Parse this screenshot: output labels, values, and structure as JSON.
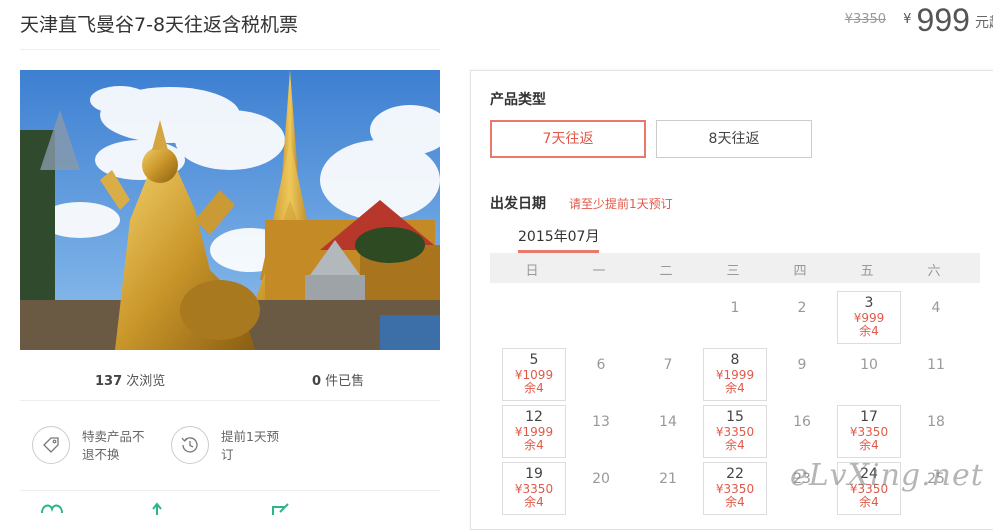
{
  "product": {
    "title": "天津直飞曼谷7-8天往返含税机票",
    "old_price": "¥3350",
    "currency": "¥",
    "price": "999",
    "price_unit": "元起"
  },
  "stats": {
    "views_count": "137",
    "views_label": " 次浏览",
    "sold_count": "0",
    "sold_label": " 件已售"
  },
  "features": [
    {
      "text": "特卖产品不退不换",
      "icon": "tag-icon"
    },
    {
      "text": "提前1天预订",
      "icon": "clock-history-icon"
    }
  ],
  "booking": {
    "type_label": "产品类型",
    "types": [
      "7天往返",
      "8天往返"
    ],
    "selected_type": "7天往返",
    "date_label": "出发日期",
    "date_hint": "请至少提前1天预订",
    "month": "2015年07月",
    "weekdays": [
      "日",
      "一",
      "二",
      "三",
      "四",
      "五",
      "六"
    ],
    "days": [
      {
        "day": "1"
      },
      {
        "day": "2"
      },
      {
        "day": "3",
        "price": "¥999",
        "remain": "余4"
      },
      {
        "day": "4"
      },
      {
        "day": "5",
        "price": "¥1099",
        "remain": "余4"
      },
      {
        "day": "6"
      },
      {
        "day": "7"
      },
      {
        "day": "8",
        "price": "¥1999",
        "remain": "余4"
      },
      {
        "day": "9"
      },
      {
        "day": "10"
      },
      {
        "day": "11"
      },
      {
        "day": "12",
        "price": "¥1999",
        "remain": "余4"
      },
      {
        "day": "13"
      },
      {
        "day": "14"
      },
      {
        "day": "15",
        "price": "¥3350",
        "remain": "余4"
      },
      {
        "day": "16"
      },
      {
        "day": "17",
        "price": "¥3350",
        "remain": "余4"
      },
      {
        "day": "18"
      },
      {
        "day": "19",
        "price": "¥3350",
        "remain": "余4"
      },
      {
        "day": "20"
      },
      {
        "day": "21"
      },
      {
        "day": "22",
        "price": "¥3350",
        "remain": "余4"
      },
      {
        "day": "23"
      },
      {
        "day": "24",
        "price": "¥3350",
        "remain": "余4"
      },
      {
        "day": "25"
      }
    ]
  },
  "watermark": "eLvXing.net",
  "colors": {
    "accent": "#e05a4a",
    "accent_border": "#e87a6c",
    "bottom_icons": "#2fb38a"
  }
}
